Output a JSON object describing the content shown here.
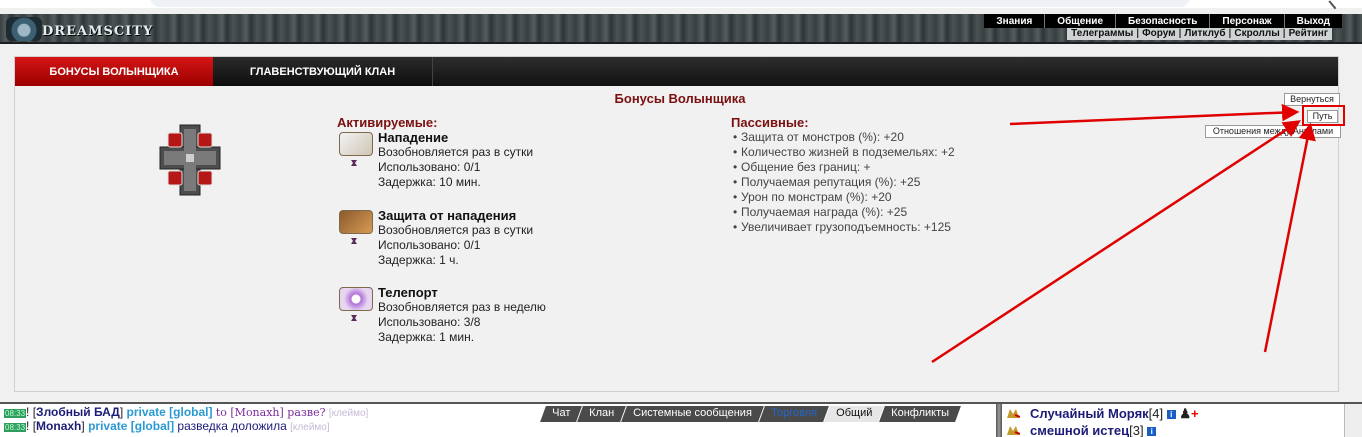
{
  "header": {
    "logo_text": "DREAMSCITY",
    "top_menu": [
      "Знания",
      "Общение",
      "Безопасность",
      "Персонаж",
      "Выход"
    ],
    "sub_menu": [
      "Телеграммы",
      "Форум",
      "Литклуб",
      "Скроллы",
      "Рейтинг"
    ]
  },
  "tabs": {
    "bonuses": "БОНУСЫ ВОЛЫНЩИКА",
    "clan": "ГЛАВЕНСТВУЮЩИЙ КЛАН"
  },
  "panel": {
    "title": "Бонусы Волынщика",
    "back_button": "Вернуться",
    "path_button": "Путь",
    "relations_button": "Отношения между Ангелами"
  },
  "active": {
    "title": "Активируемые:",
    "skills": [
      {
        "name": "Нападение",
        "renew": "Возобновляется раз в сутки",
        "used": "Использовано: 0/1",
        "delay": "Задержка: 10 мин."
      },
      {
        "name": "Защита от нападения",
        "renew": "Возобновляется раз в сутки",
        "used": "Использовано: 0/1",
        "delay": "Задержка: 1 ч."
      },
      {
        "name": "Телепорт",
        "renew": "Возобновляется раз в неделю",
        "used": "Использовано: 3/8",
        "delay": "Задержка: 1 мин."
      }
    ]
  },
  "passive": {
    "title": "Пассивные:",
    "items": [
      "Защита от монстров (%): +20",
      "Количество жизней в подземельях: +2",
      "Общение без границ: +",
      "Получаемая репутация (%): +25",
      "Урон по монстрам (%): +20",
      "Получаемая награда (%): +25",
      "Увеличивает грузоподъемность: +125"
    ]
  },
  "chat": {
    "lines": [
      {
        "time": "08:33",
        "nick": "Злобный БАД",
        "private": "private [global]",
        "to": "to [Monaxh] разве?",
        "msg": "",
        "stamp": "[клеймо]"
      },
      {
        "time": "08:33",
        "nick": "Monaxh",
        "private": "private [global]",
        "to": "",
        "msg": "разведка доложила",
        "stamp": "[клеймо]"
      }
    ],
    "tabs": [
      "Чат",
      "Клан",
      "Системные сообщения",
      "Торговля",
      "Общий",
      "Конфликты"
    ]
  },
  "online": [
    {
      "name": "Случайный Моряк",
      "level": "[4]"
    },
    {
      "name": "смешной истец",
      "level": "[3]"
    }
  ],
  "colors": {
    "accent_red": "#c80000",
    "title_red": "#7a1010",
    "annotation_red": "#e00000"
  }
}
